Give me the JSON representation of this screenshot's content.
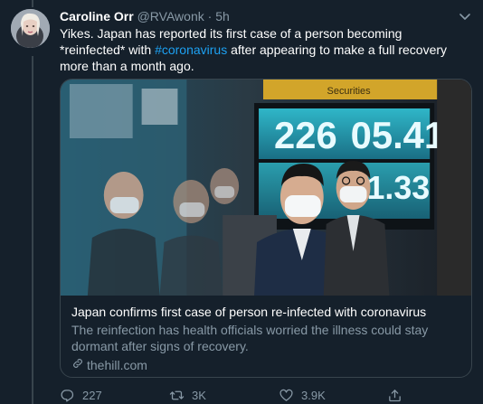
{
  "tweet": {
    "author_name": "Caroline Orr",
    "author_handle": "@RVAwonk",
    "separator": "·",
    "time": "5h",
    "text_before": "Yikes. Japan has reported its first case of a person becoming *reinfected* with ",
    "hashtag": "#coronavirus",
    "text_after": " after appearing to make a full recovery more than a month ago."
  },
  "card": {
    "title": "Japan confirms first case of person re-infected with coronavirus",
    "description": "The reinfection has health officials worried the illness could stay dormant after signs of recovery.",
    "domain": "thehill.com",
    "image": {
      "ticker_primary": "226",
      "ticker_secondary": "05.41",
      "ticker_lower": "1.33",
      "sign_text": "Securities"
    }
  },
  "actions": {
    "reply_count": "227",
    "retweet_count": "3K",
    "like_count": "3.9K"
  },
  "icons": {
    "reply": "reply-icon",
    "retweet": "retweet-icon",
    "like": "heart-icon",
    "share": "share-icon",
    "caret": "chevron-down-icon",
    "link": "link-icon"
  },
  "colors": {
    "background": "#15202b",
    "accent": "#1da1f2",
    "muted": "#8899a6",
    "border": "#38444d"
  }
}
